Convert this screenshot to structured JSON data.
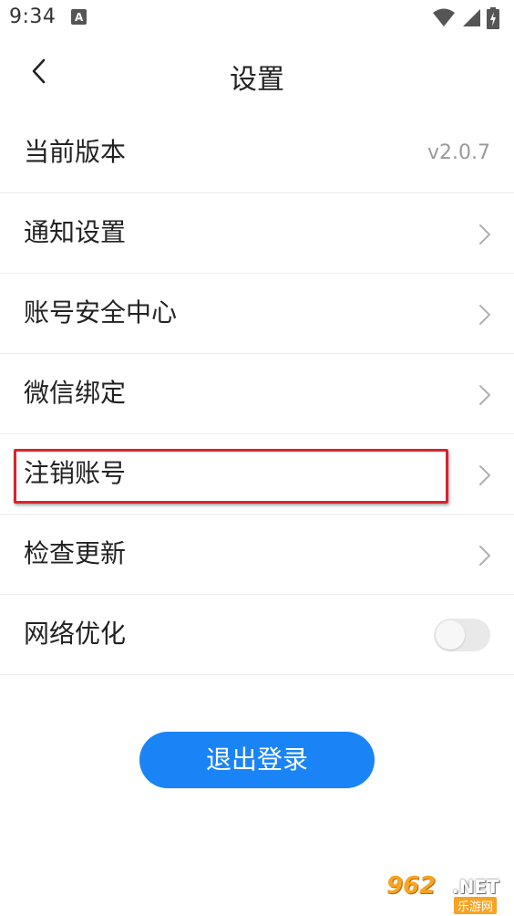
{
  "status_bar": {
    "time": "9:34"
  },
  "header": {
    "title": "设置"
  },
  "settings": [
    {
      "label": "当前版本",
      "value": "v2.0.7",
      "type": "value"
    },
    {
      "label": "通知设置",
      "type": "link"
    },
    {
      "label": "账号安全中心",
      "type": "link"
    },
    {
      "label": "微信绑定",
      "type": "link"
    },
    {
      "label": "注销账号",
      "type": "link",
      "highlighted": true
    },
    {
      "label": "检查更新",
      "type": "link"
    },
    {
      "label": "网络优化",
      "type": "toggle",
      "toggle_on": false
    }
  ],
  "logout_label": "退出登录",
  "colors": {
    "accent": "#1a84f7",
    "highlight": "#d9232d"
  },
  "watermark": {
    "logo": "962",
    "suffix": ".NET",
    "cn": "乐游网"
  }
}
